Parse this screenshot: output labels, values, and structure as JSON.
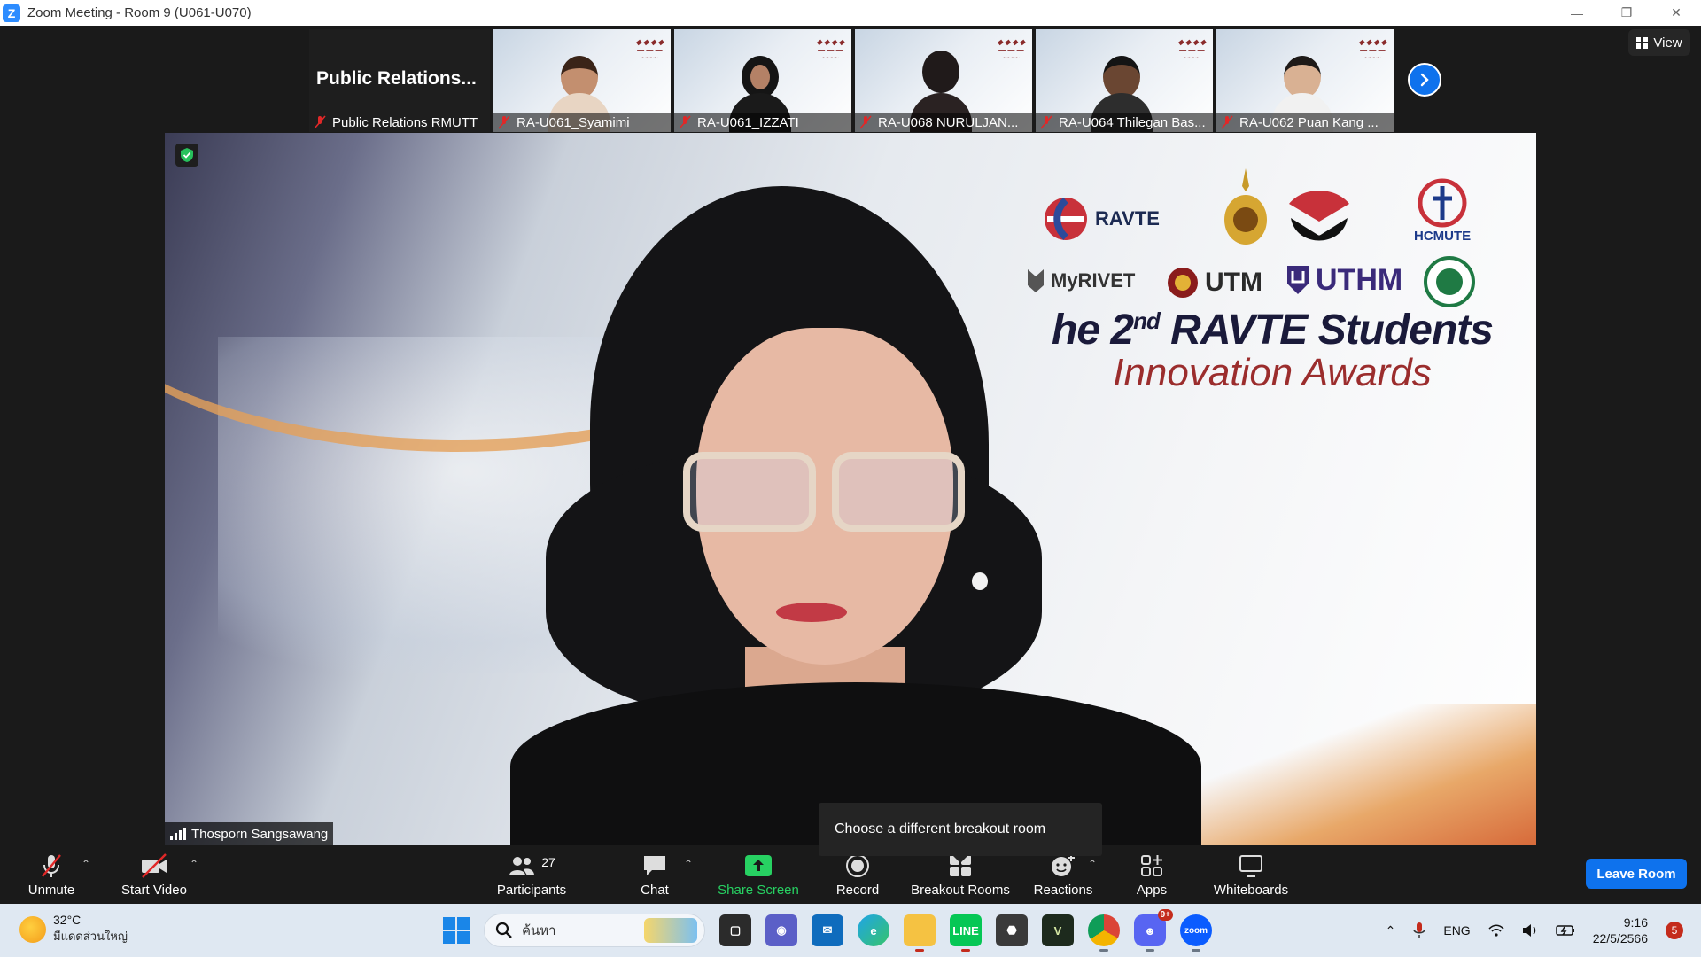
{
  "window": {
    "title": "Zoom Meeting - Room 9 (U061-U070)",
    "controls": [
      "minimize",
      "restore",
      "close"
    ]
  },
  "gallery": {
    "tiles": [
      {
        "display_title": "Public  Relations...",
        "label": "Public Relations RMUTT",
        "muted": true
      },
      {
        "label": "RA-U061_Syamimi",
        "muted": true
      },
      {
        "label": "RA-U061_IZZATI",
        "muted": true
      },
      {
        "label": "RA-U068 NURULJAN...",
        "muted": true
      },
      {
        "label": "RA-U064 Thilegan Bas...",
        "muted": true
      },
      {
        "label": "RA-U062 Puan Kang ...",
        "muted": true
      }
    ],
    "next_icon": "chevron-right-icon",
    "view_label": "View"
  },
  "main_video": {
    "speaker_name": "Thosporn Sangsawang",
    "banner": {
      "logo_texts": [
        "RAVTE",
        "HCMUTE",
        "MyRIVET",
        "UTM",
        "UTHM"
      ],
      "line1_pre": "he 2",
      "line1_sup": "nd",
      "line1_post": " RAVTE Students",
      "line2": "Innovation Awards"
    }
  },
  "tooltip": {
    "text": "Choose a different breakout room"
  },
  "toolbar": {
    "unmute": "Unmute",
    "start_video": "Start Video",
    "participants": "Participants",
    "participants_count": "27",
    "chat": "Chat",
    "share_screen": "Share Screen",
    "record": "Record",
    "breakout_rooms": "Breakout Rooms",
    "reactions": "Reactions",
    "apps": "Apps",
    "whiteboards": "Whiteboards",
    "leave_room": "Leave Room",
    "share_color": "#27d162",
    "leave_color": "#0e72ed"
  },
  "taskbar": {
    "weather_temp": "32°C",
    "weather_desc": "มีแดดส่วนใหญ่",
    "search_placeholder": "ค้นหา",
    "language": "ENG",
    "time": "9:16",
    "date": "22/5/2566",
    "notification_count": "5",
    "discord_badge": "9+"
  }
}
